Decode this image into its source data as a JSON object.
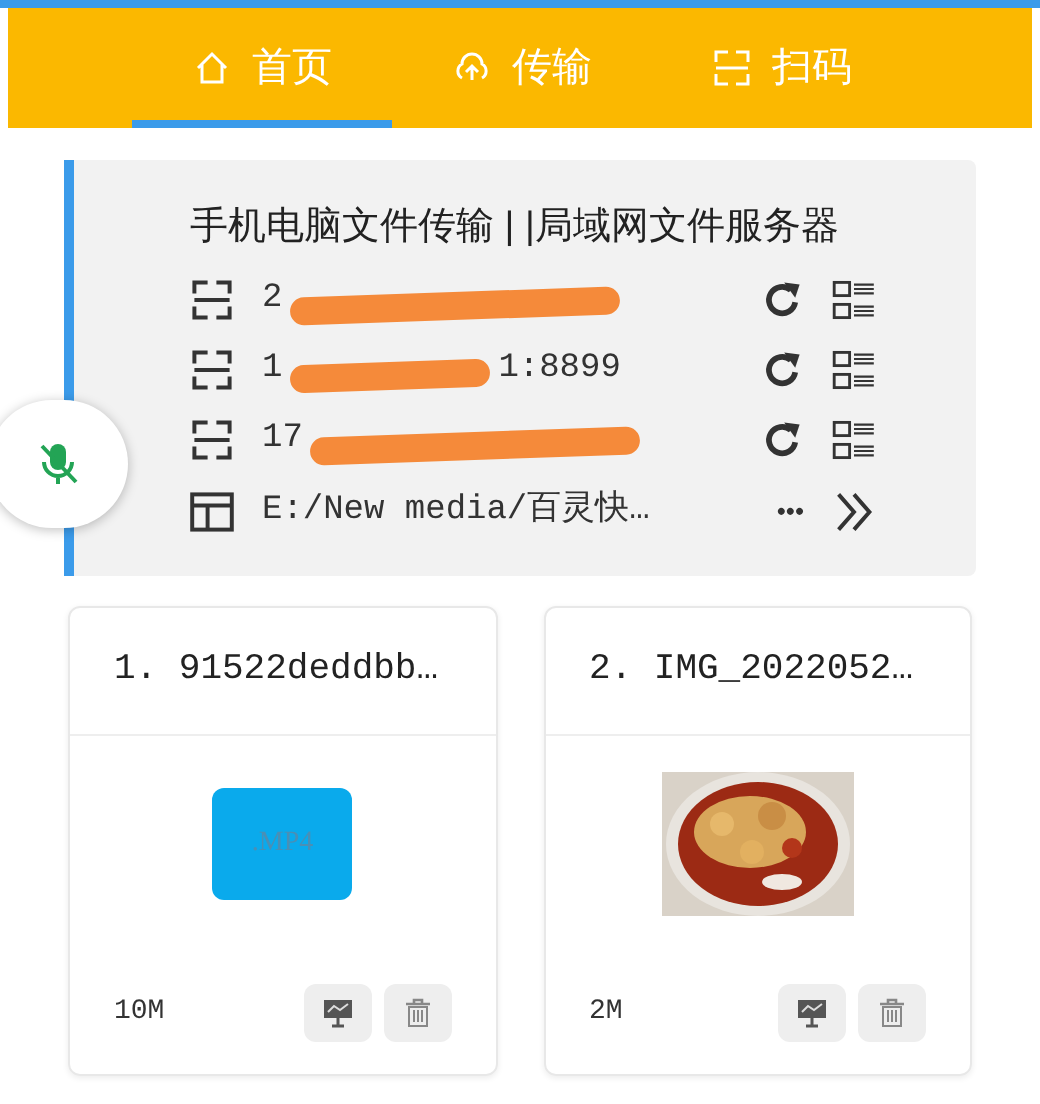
{
  "tabs": [
    {
      "label": "首页",
      "selected": true
    },
    {
      "label": "传输",
      "selected": false
    },
    {
      "label": "扫码",
      "selected": false
    }
  ],
  "server": {
    "title": "手机电脑文件传输 | |局域网文件服务器",
    "addresses": [
      {
        "prefix": "2",
        "redacted": true
      },
      {
        "prefix": "1",
        "suffix": "1:8899",
        "redacted": true
      },
      {
        "prefix": "17",
        "redacted": true
      }
    ],
    "folder": {
      "path": "E:/New media/百灵快…",
      "more": "•••"
    }
  },
  "mic_button": {
    "muted": true
  },
  "files": [
    {
      "name": "1. 91522deddbb…",
      "size": "10M",
      "kind": "video",
      "ext": ".MP4"
    },
    {
      "name": "2. IMG_2022052…",
      "size": "2M",
      "kind": "picture"
    }
  ]
}
